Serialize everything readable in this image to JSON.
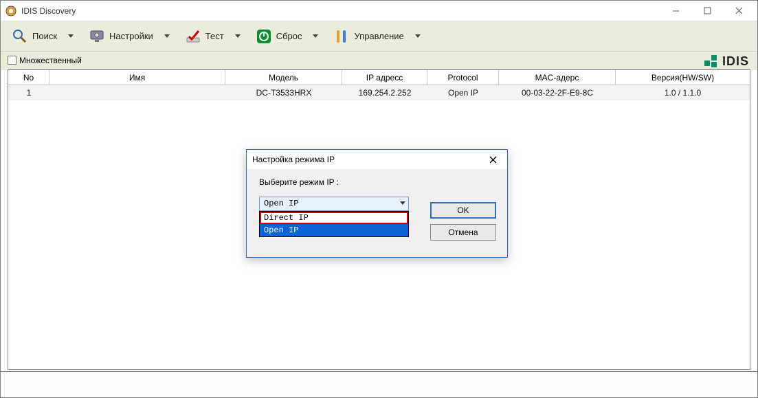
{
  "window": {
    "title": "IDIS Discovery"
  },
  "toolbar": {
    "search": "Поиск",
    "settings": "Настройки",
    "test": "Тест",
    "reset": "Сброс",
    "manage": "Управление"
  },
  "subbar": {
    "multi_label": "Множественный"
  },
  "brand": {
    "text": "IDIS"
  },
  "table": {
    "headers": {
      "no": "No",
      "name": "Имя",
      "model": "Модель",
      "ip": "IP адресс",
      "protocol": "Protocol",
      "mac": "MAC-адерс",
      "version": "Версия(HW/SW)"
    },
    "rows": [
      {
        "no": "1",
        "name": "",
        "model": "DC-T3533HRX",
        "ip": "169.254.2.252",
        "protocol": "Open IP",
        "mac": "00-03-22-2F-E9-8C",
        "version": "1.0 / 1.1.0"
      }
    ]
  },
  "modal": {
    "title": "Настройка режима IP",
    "label": "Выберите режим IP :",
    "selected": "Open IP",
    "options": [
      "Direct IP",
      "Open IP"
    ],
    "ok": "OK",
    "cancel": "Отмена"
  }
}
